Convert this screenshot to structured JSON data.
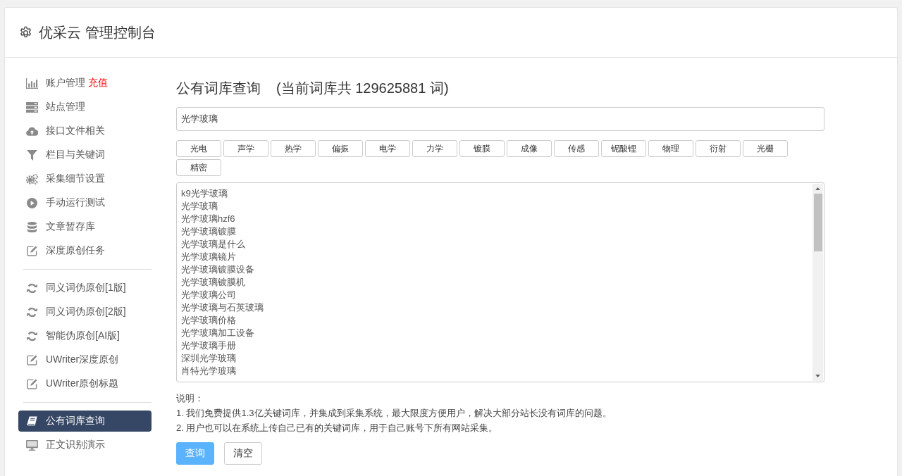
{
  "header": {
    "title": "优采云 管理控制台"
  },
  "sidebar": {
    "groups": [
      {
        "items": [
          {
            "label": "账户管理",
            "badge": "充值",
            "selected": false
          },
          {
            "label": "站点管理",
            "selected": false
          },
          {
            "label": "接口文件相关",
            "selected": false
          },
          {
            "label": "栏目与关键词",
            "selected": false
          },
          {
            "label": "采集细节设置",
            "selected": false
          },
          {
            "label": "手动运行测试",
            "selected": false
          },
          {
            "label": "文章暂存库",
            "selected": false
          },
          {
            "label": "深度原创任务",
            "selected": false
          }
        ]
      },
      {
        "items": [
          {
            "label": "同义词伪原创[1版]",
            "selected": false
          },
          {
            "label": "同义词伪原创[2版]",
            "selected": false
          },
          {
            "label": "智能伪原创[AI版]",
            "selected": false
          },
          {
            "label": "UWriter深度原创",
            "selected": false
          },
          {
            "label": "UWriter原创标题",
            "selected": false
          }
        ]
      },
      {
        "items": [
          {
            "label": "公有词库查询",
            "selected": true
          },
          {
            "label": "正文识别演示",
            "selected": false
          }
        ]
      }
    ]
  },
  "main": {
    "title": "公有词库查询",
    "count": "(当前词库共 129625881 词)",
    "search": {
      "value": "光学玻璃"
    },
    "tags": [
      {
        "label": "光电"
      },
      {
        "label": "声学"
      },
      {
        "label": "热学"
      },
      {
        "label": "偏振"
      },
      {
        "label": "电学"
      },
      {
        "label": "力学"
      },
      {
        "label": "镀膜"
      },
      {
        "label": "成像"
      },
      {
        "label": "传感"
      },
      {
        "label": "铌酸锂"
      },
      {
        "label": "物理"
      },
      {
        "label": "衍射"
      },
      {
        "label": "光栅"
      },
      {
        "label": "精密"
      }
    ],
    "results": [
      "k9光学玻璃",
      "光学玻璃",
      "光学玻璃hzf6",
      "光学玻璃镀膜",
      "光学玻璃是什么",
      "光学玻璃镜片",
      "光学玻璃镀膜设备",
      "光学玻璃镀膜机",
      "光学玻璃公司",
      "光学玻璃与石英玻璃",
      "光学玻璃价格",
      "光学玻璃加工设备",
      "光学玻璃手册",
      "深圳光学玻璃",
      "肖特光学玻璃"
    ],
    "notes": {
      "title": "说明：",
      "lines": [
        "1. 我们免费提供1.3亿关键词库，并集成到采集系统，最大限度方便用户，解决大部分站长没有词库的问题。",
        "2. 用户也可以在系统上传自己已有的关键词库，用于自己账号下所有网站采集。"
      ]
    },
    "buttons": [
      {
        "label": "查询",
        "kind": "primary"
      },
      {
        "label": "清空",
        "kind": "default"
      }
    ]
  }
}
